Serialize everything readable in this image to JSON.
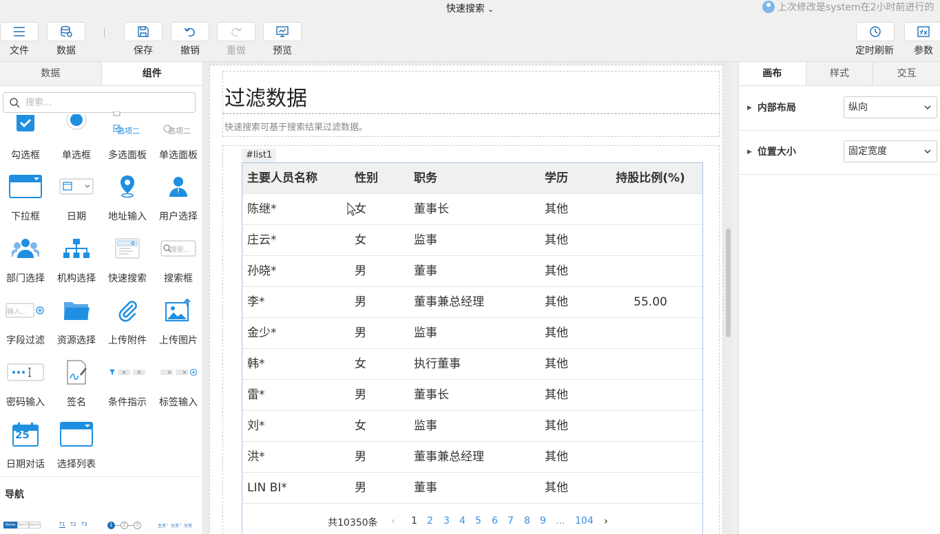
{
  "header": {
    "title": "快速搜索",
    "last_modified": "上次修改是system在2小时前进行的"
  },
  "toolbar": {
    "file": "文件",
    "data": "数据",
    "save": "保存",
    "undo": "撤销",
    "redo": "重做",
    "preview": "预览",
    "timed_refresh": "定时刷新",
    "params": "参数"
  },
  "left_panel": {
    "tabs": [
      "数据",
      "组件"
    ],
    "search_placeholder": "搜索...",
    "components": [
      {
        "label": "勾选框",
        "icon": "checkbox-icon"
      },
      {
        "label": "单选框",
        "icon": "radio-icon"
      },
      {
        "label": "多选面板",
        "icon": "multi-select-panel-icon"
      },
      {
        "label": "单选面板",
        "icon": "single-select-panel-icon"
      },
      {
        "label": "下拉框",
        "icon": "dropdown-icon"
      },
      {
        "label": "日期",
        "icon": "date-icon"
      },
      {
        "label": "地址输入",
        "icon": "location-pin-icon"
      },
      {
        "label": "用户选择",
        "icon": "user-icon"
      },
      {
        "label": "部门选择",
        "icon": "department-icon"
      },
      {
        "label": "机构选择",
        "icon": "org-chart-icon"
      },
      {
        "label": "快速搜索",
        "icon": "quick-search-icon"
      },
      {
        "label": "搜索框",
        "icon": "search-box-icon"
      },
      {
        "label": "字段过滤",
        "icon": "field-filter-icon"
      },
      {
        "label": "资源选择",
        "icon": "folder-icon"
      },
      {
        "label": "上传附件",
        "icon": "paperclip-icon"
      },
      {
        "label": "上传图片",
        "icon": "image-upload-icon"
      },
      {
        "label": "密码输入",
        "icon": "password-icon"
      },
      {
        "label": "签名",
        "icon": "signature-icon"
      },
      {
        "label": "条件指示",
        "icon": "condition-indicator-icon"
      },
      {
        "label": "标签输入",
        "icon": "tag-input-icon"
      },
      {
        "label": "日期对话",
        "icon": "calendar-icon"
      },
      {
        "label": "选择列表",
        "icon": "select-list-icon"
      }
    ],
    "icon_snippets": {
      "option2": "选项二",
      "search": "搜索...",
      "input": "输入...",
      "calendar_day": "25"
    },
    "nav_heading": "导航",
    "nav_thumbs": [
      "Home",
      "Item1",
      "Item2",
      "T1",
      "T2",
      "T3",
      "1",
      "2",
      "3",
      "主页",
      "分页",
      "分页"
    ]
  },
  "canvas": {
    "page_title": "过滤数据",
    "page_desc": "快速搜索可基于搜索结果过滤数据。",
    "list_tag": "#list1",
    "table": {
      "headers": [
        "主要人员名称",
        "性别",
        "职务",
        "学历",
        "持股比例(%)"
      ],
      "rows": [
        [
          "陈继*",
          "女",
          "董事长",
          "其他",
          ""
        ],
        [
          "庄云*",
          "女",
          "监事",
          "其他",
          ""
        ],
        [
          "孙晓*",
          "男",
          "董事",
          "其他",
          ""
        ],
        [
          "李*",
          "男",
          "董事兼总经理",
          "其他",
          "55.00"
        ],
        [
          "金少*",
          "男",
          "监事",
          "其他",
          ""
        ],
        [
          "韩*",
          "女",
          "执行董事",
          "其他",
          ""
        ],
        [
          "雷*",
          "男",
          "董事长",
          "其他",
          ""
        ],
        [
          "刘*",
          "女",
          "监事",
          "其他",
          ""
        ],
        [
          "洪*",
          "男",
          "董事兼总经理",
          "其他",
          ""
        ],
        [
          "LIN BI*",
          "男",
          "董事",
          "其他",
          ""
        ]
      ]
    },
    "pager": {
      "total": "共10350条",
      "prev": "‹",
      "pages": [
        "1",
        "2",
        "3",
        "4",
        "5",
        "6",
        "7",
        "8",
        "9"
      ],
      "ellipsis": "...",
      "last": "104",
      "next": "›",
      "current": "1"
    }
  },
  "right_panel": {
    "tabs": [
      "画布",
      "样式",
      "交互"
    ],
    "props": [
      {
        "label": "内部布局",
        "value": "纵向"
      },
      {
        "label": "位置大小",
        "value": "固定宽度"
      }
    ]
  },
  "colors": {
    "accent": "#1e8fe1",
    "link": "#3a8ee6",
    "table_border": "#aac4e0"
  }
}
